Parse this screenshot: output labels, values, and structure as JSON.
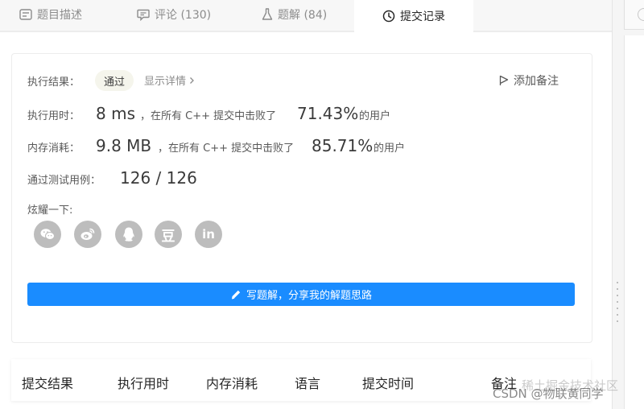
{
  "tabs": [
    {
      "label": "题目描述",
      "icon": "description-icon"
    },
    {
      "label": "评论 (130)",
      "icon": "comment-icon"
    },
    {
      "label": "题解 (84)",
      "icon": "flask-icon"
    },
    {
      "label": "提交记录",
      "icon": "clock-icon"
    }
  ],
  "result": {
    "status_label": "执行结果：",
    "status_value": "通过",
    "details_link": "显示详情",
    "add_note": "添加备注",
    "runtime_label": "执行用时：",
    "runtime_value": "8 ms",
    "runtime_mid": "，在所有 C++ 提交中击败了",
    "runtime_percent": "71.43%",
    "runtime_suffix": "的用户",
    "memory_label": "内存消耗：",
    "memory_value": "9.8 MB",
    "memory_mid": "，在所有 C++ 提交中击败了",
    "memory_percent": "85.71%",
    "memory_suffix": "的用户",
    "tests_label": "通过测试用例：",
    "tests_value": "126 / 126",
    "share_label": "炫耀一下:",
    "share_icons": [
      "wechat-icon",
      "weibo-icon",
      "qq-icon",
      "douban-icon",
      "linkedin-icon"
    ],
    "douban_glyph": "豆",
    "linkedin_glyph": "in",
    "write_button": "写题解，分享我的解题思路"
  },
  "table_headers": [
    "提交结果",
    "执行用时",
    "内存消耗",
    "语言",
    "提交时间",
    "备注"
  ],
  "watermark": {
    "line1": "稀土掘金技术社区",
    "line2": "CSDN @物联黄同学"
  }
}
